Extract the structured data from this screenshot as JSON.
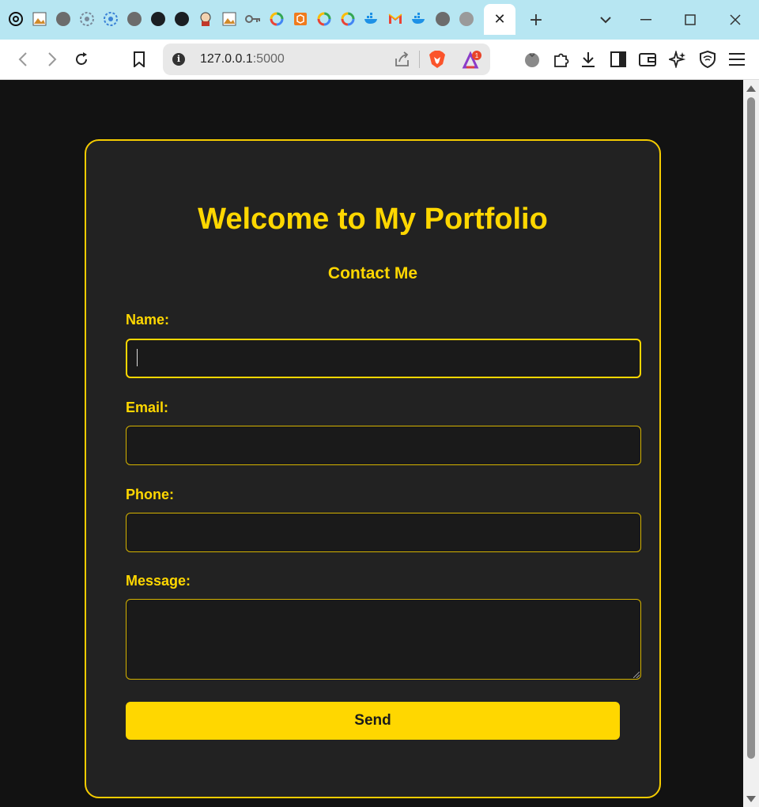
{
  "browser": {
    "active_tab_close": "✕",
    "new_tab": "+",
    "url_host": "127.0.0.1",
    "url_port": ":5000",
    "rewards_badge": "1",
    "tab_icons": [
      "openai-icon",
      "image-icon",
      "globe-icon",
      "chromium-icon",
      "tauri-icon",
      "globe-icon",
      "github-icon",
      "github-icon",
      "jenkins-icon",
      "image-icon",
      "key-icon",
      "google-icon",
      "package-icon",
      "google-icon",
      "google-icon",
      "docker-icon",
      "gmail-icon",
      "docker-icon",
      "globe-icon",
      "globe-icon"
    ],
    "colors": {
      "tabstrip": "#b7e6f2",
      "accent": "#ffd700",
      "page_bg": "#121212",
      "card_bg": "#222222"
    }
  },
  "page": {
    "title": "Welcome to My Portfolio",
    "subtitle": "Contact Me",
    "form": {
      "name_label": "Name:",
      "name_value": "",
      "email_label": "Email:",
      "email_value": "",
      "phone_label": "Phone:",
      "phone_value": "",
      "message_label": "Message:",
      "message_value": "",
      "submit_label": "Send"
    }
  }
}
